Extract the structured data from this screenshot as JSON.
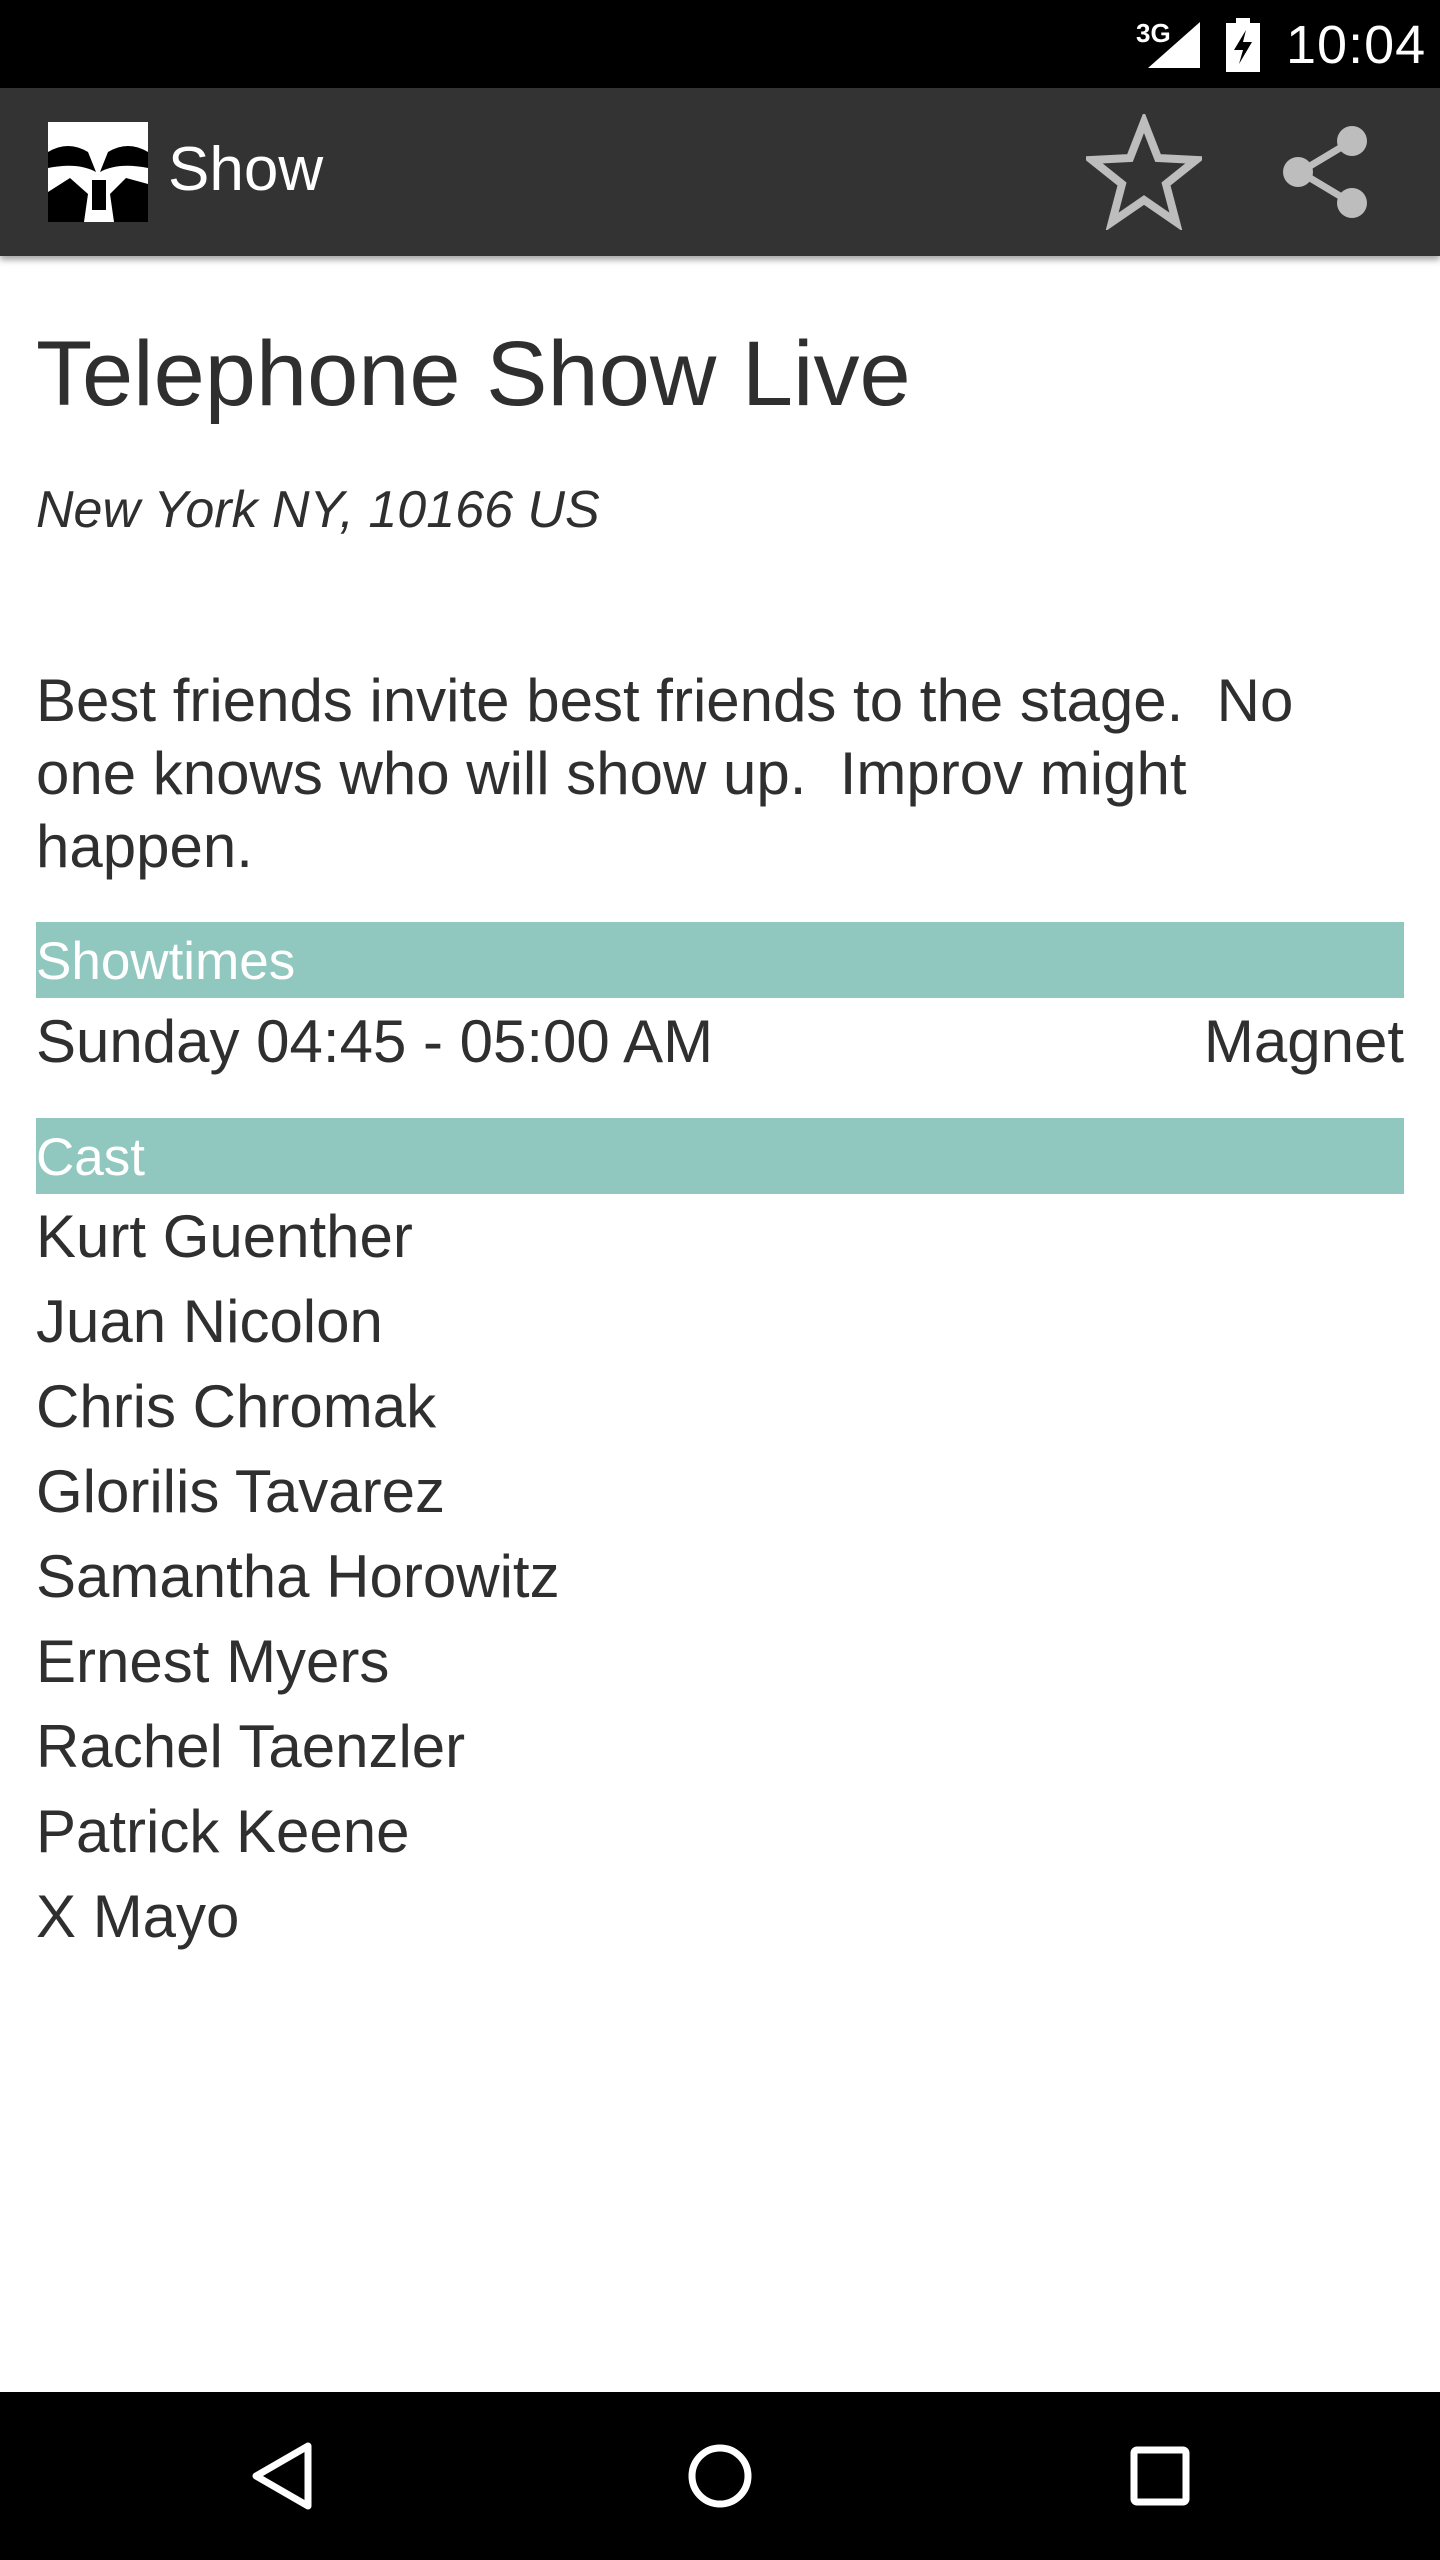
{
  "status_bar": {
    "network": "3G",
    "time": "10:04",
    "icons": [
      "signal-icon",
      "battery-charging-icon"
    ]
  },
  "action_bar": {
    "title": "Show",
    "icons": [
      "app-logo-icon",
      "star-outline-icon",
      "share-icon"
    ]
  },
  "show": {
    "title": "Telephone Show Live",
    "location": "New York NY, 10166 US",
    "description": "Best friends invite best friends to the stage.  No one knows who will show up.  Improv might happen."
  },
  "showtimes": {
    "header": "Showtimes",
    "items": [
      {
        "time": "Sunday 04:45 - 05:00 AM",
        "venue": "Magnet"
      }
    ]
  },
  "cast": {
    "header": "Cast",
    "members": [
      "Kurt Guenther",
      "Juan Nicolon",
      "Chris Chromak",
      "Glorilis Tavarez",
      "Samantha Horowitz",
      "Ernest Myers",
      "Rachel Taenzler",
      "Patrick Keene",
      "X Mayo"
    ]
  },
  "nav_bar": {
    "icons": [
      "back-icon",
      "home-icon",
      "recents-icon"
    ]
  },
  "colors": {
    "section_header": "#90c8bf",
    "action_bar": "#333333",
    "text": "#2f2f2f"
  }
}
